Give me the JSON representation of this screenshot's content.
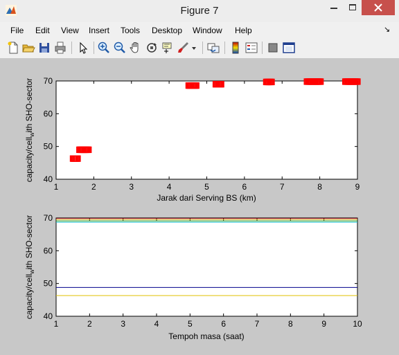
{
  "window": {
    "title": "Figure 7"
  },
  "menu": {
    "items": [
      "File",
      "Edit",
      "View",
      "Insert",
      "Tools",
      "Desktop",
      "Window",
      "Help"
    ]
  },
  "toolbar": {
    "icons": [
      "new-figure-icon",
      "open-file-icon",
      "save-icon",
      "print-icon",
      "edit-plot-arrow-icon",
      "zoom-in-icon",
      "zoom-out-icon",
      "pan-hand-icon",
      "rotate-3d-icon",
      "data-cursor-icon",
      "brush-icon",
      "link-plot-icon",
      "colorbar-icon",
      "legend-icon",
      "hide-plot-tools-icon",
      "show-plot-tools-icon"
    ]
  },
  "chart_data": [
    {
      "type": "scatter",
      "xlabel": "Jarak dari Serving BS (km)",
      "ylabel_parts": [
        "capacity/cell",
        "w",
        "ith SHO-sector"
      ],
      "xlim": [
        1,
        9
      ],
      "ylim": [
        40,
        70
      ],
      "xticks": [
        1,
        2,
        3,
        4,
        5,
        6,
        7,
        8,
        9
      ],
      "yticks": [
        40,
        50,
        60,
        70
      ],
      "color": "#ff0000",
      "marker": "square",
      "series": [
        {
          "x": [
            1.45,
            1.47,
            1.49,
            1.51,
            1.53,
            1.55,
            1.57
          ],
          "y": [
            46.3,
            46.3,
            46.3,
            46.3,
            46.3,
            46.3,
            46.3
          ]
        },
        {
          "x": [
            1.62,
            1.64,
            1.66,
            1.68,
            1.7,
            1.72,
            1.74,
            1.76,
            1.78,
            1.8,
            1.82,
            1.84,
            1.86
          ],
          "y": [
            49,
            49,
            49,
            49,
            49,
            49,
            49,
            49,
            49,
            49,
            49,
            49,
            49
          ]
        },
        {
          "x": [
            4.52,
            4.54,
            4.56,
            4.58,
            4.6,
            4.62,
            4.64,
            4.66,
            4.68,
            4.7,
            4.72
          ],
          "y": [
            68.6,
            68.6,
            68.6,
            68.6,
            68.6,
            68.6,
            68.6,
            68.6,
            68.6,
            68.6,
            68.6
          ]
        },
        {
          "x": [
            5.24,
            5.26,
            5.28,
            5.3,
            5.32,
            5.34,
            5.36,
            5.38
          ],
          "y": [
            69,
            69,
            69,
            69,
            69,
            69,
            69,
            69
          ]
        },
        {
          "x": [
            6.58,
            6.6,
            6.62,
            6.64,
            6.66,
            6.68,
            6.7,
            6.72
          ],
          "y": [
            69.7,
            69.7,
            69.7,
            69.7,
            69.7,
            69.7,
            69.7,
            69.7
          ]
        },
        {
          "x": [
            7.66,
            7.68,
            7.7,
            7.72,
            7.74,
            7.76,
            7.78,
            7.8,
            7.82,
            7.84,
            7.86,
            7.88,
            7.9,
            7.92,
            7.94,
            7.96,
            7.98,
            8.0,
            8.02
          ],
          "y": [
            69.8,
            69.8,
            69.8,
            69.8,
            69.8,
            69.8,
            69.8,
            69.8,
            69.8,
            69.8,
            69.8,
            69.8,
            69.8,
            69.8,
            69.8,
            69.8,
            69.8,
            69.8,
            69.8
          ]
        },
        {
          "x": [
            8.68,
            8.7,
            8.72,
            8.74,
            8.76,
            8.78,
            8.8,
            8.82,
            8.84,
            8.86,
            8.88,
            8.9,
            8.92,
            8.94,
            8.96,
            8.98,
            9.0
          ],
          "y": [
            69.8,
            69.8,
            69.8,
            69.8,
            69.8,
            69.8,
            69.8,
            69.8,
            69.8,
            69.8,
            69.8,
            69.8,
            69.8,
            69.8,
            69.8,
            69.8,
            69.8
          ]
        }
      ]
    },
    {
      "type": "line",
      "xlabel": "Tempoh masa (saat)",
      "ylabel_parts": [
        "capacity/cell",
        "w",
        "ith SHO-sector"
      ],
      "xlim": [
        1,
        10
      ],
      "ylim": [
        40,
        70
      ],
      "xticks": [
        1,
        2,
        3,
        4,
        5,
        6,
        7,
        8,
        9,
        10
      ],
      "yticks": [
        40,
        50,
        60,
        70
      ],
      "series": [
        {
          "x": [
            1,
            10
          ],
          "y": [
            69.9,
            69.9
          ],
          "color": "#8b0000"
        },
        {
          "x": [
            1,
            10
          ],
          "y": [
            69.5,
            69.5
          ],
          "color": "#d4a017"
        },
        {
          "x": [
            1,
            10
          ],
          "y": [
            69.1,
            69.1
          ],
          "color": "#2ca02c"
        },
        {
          "x": [
            1,
            10
          ],
          "y": [
            68.7,
            68.7
          ],
          "color": "#17becf"
        },
        {
          "x": [
            1,
            10
          ],
          "y": [
            48.8,
            48.8
          ],
          "color": "#00008b"
        },
        {
          "x": [
            1,
            10
          ],
          "y": [
            46.3,
            46.3
          ],
          "color": "#e0c000"
        }
      ]
    }
  ]
}
